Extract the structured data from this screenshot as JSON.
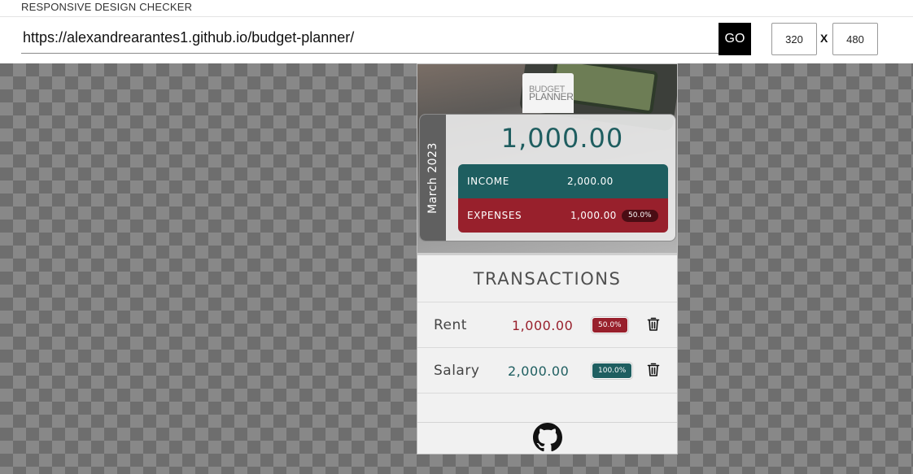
{
  "tool": {
    "title": "RESPONSIVE DESIGN CHECKER",
    "url": "https://alexandrearantes1.github.io/budget-planner/",
    "go_label": "GO",
    "width": "320",
    "separator": "X",
    "height": "480"
  },
  "app": {
    "logo_top": "BUDGET",
    "logo_bottom": "PLANNER",
    "month": "March 2023",
    "balance": "1,000.00",
    "income_label": "INCOME",
    "income_value": "2,000.00",
    "expenses_label": "EXPENSES",
    "expenses_value": "1,000.00",
    "expenses_pct": "50.0%",
    "transactions_title": "TRANSACTIONS",
    "transactions": [
      {
        "name": "Rent",
        "amount": "1,000.00",
        "pct": "50.0%",
        "type": "expense"
      },
      {
        "name": "Salary",
        "amount": "2,000.00",
        "pct": "100.0%",
        "type": "income"
      }
    ]
  },
  "colors": {
    "teal": "#1e5e60",
    "crimson": "#98202c",
    "month_tab": "#606060",
    "go_button": "#000000"
  },
  "icons": {
    "delete": "trash-icon",
    "footer": "github-icon"
  }
}
